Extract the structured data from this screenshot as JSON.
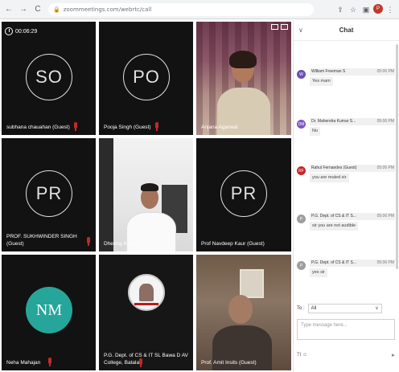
{
  "browser": {
    "back": "←",
    "forward": "→",
    "reload": "C",
    "url": "zoommeetings.com/webrtc/call",
    "share_icon": "share-icon",
    "star_icon": "star-icon",
    "profile_letter": "P",
    "menu_icon": "⋮"
  },
  "meeting": {
    "timer": "00:06:29",
    "tiles": [
      {
        "initials": "SO",
        "name": "subhana chauahan (Guest)"
      },
      {
        "initials": "PO",
        "name": "Pooja Singh (Guest)"
      },
      {
        "initials": "",
        "name": "Anjana Agarwal"
      },
      {
        "initials": "PR",
        "name": "PROF. SUKHWINDER SINGH (Guest)"
      },
      {
        "initials": "",
        "name": "Dheeraj Kumar"
      },
      {
        "initials": "PR",
        "name": "Prof Navdeep Kaur (Guest)"
      },
      {
        "initials": "NM",
        "name": "Neha Mahajan"
      },
      {
        "initials": "",
        "name": "P.G. Dept. of CS & IT SL Bawa D AV College, Batala"
      },
      {
        "initials": "",
        "name": "Prof. Amit Insits (Guest)"
      }
    ]
  },
  "chat": {
    "title": "Chat",
    "messages": [
      {
        "avatar": "W",
        "avatar_color": "#6d4fb3",
        "sender": "William Freeman S",
        "time": "05:06 PM",
        "text": "Yes mam"
      },
      {
        "avatar": "DM",
        "avatar_color": "#7e57c2",
        "sender": "Dr. Mahendra Kumar S...",
        "time": "05:06 PM",
        "text": "No"
      },
      {
        "avatar": "RF",
        "avatar_color": "#c62828",
        "sender": "Rahul Fernandes (Guest)",
        "time": "05:06 PM",
        "text": "you are muted sir"
      },
      {
        "avatar": "P",
        "avatar_color": "#9e9e9e",
        "sender": "P.G. Dept. of CS & IT S...",
        "time": "05:06 PM",
        "text": "sir you are not audible"
      },
      {
        "avatar": "P",
        "avatar_color": "#9e9e9e",
        "sender": "P.G. Dept. of CS & IT S...",
        "time": "05:06 PM",
        "text": "yes sir"
      }
    ],
    "to_label": "To :",
    "to_value": "All",
    "input_placeholder": "Type message here...",
    "bottom_left": "Tt  ☺",
    "bottom_right": "➤"
  }
}
